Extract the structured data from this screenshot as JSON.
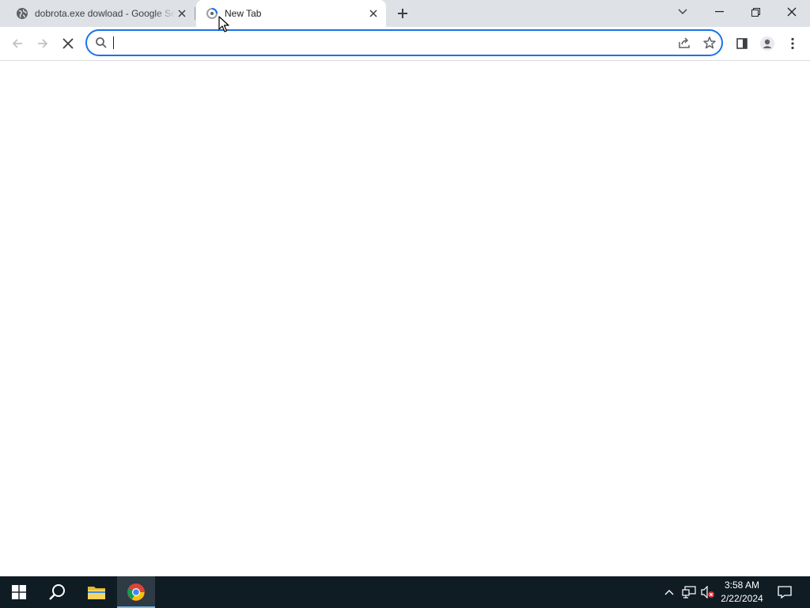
{
  "tabs": [
    {
      "title": "dobrota.exe dowload - Google Search",
      "favicon": "globe-icon",
      "active": false
    },
    {
      "title": "New Tab",
      "favicon": "loading-spinner-icon",
      "active": true
    }
  ],
  "window_controls": [
    "tab-search-icon",
    "minimize-icon",
    "restore-icon",
    "close-icon"
  ],
  "toolbar": {
    "back": "back-arrow-icon",
    "forward": "forward-arrow-icon",
    "stop": "stop-loading-icon",
    "address_value": "",
    "address_placeholder": "",
    "right_icons": [
      "share-icon",
      "bookmark-star-icon",
      "side-panel-icon",
      "profile-icon",
      "menu-kebab-icon"
    ]
  },
  "taskbar": {
    "apps": [
      "windows-start-icon",
      "search-icon",
      "file-explorer-icon",
      "chrome-icon"
    ],
    "active_app": "chrome-icon",
    "tray_icons": [
      "show-hidden-icons-chevron",
      "network-icon",
      "volume-muted-icon",
      "notification-icon"
    ],
    "time": "3:58 AM",
    "date": "2/22/2024"
  },
  "colors": {
    "tabstrip_bg": "#dee1e6",
    "accent": "#1a73e8",
    "taskbar_bg": "#101c24",
    "taskbar_active_indicator": "#76b9ed"
  }
}
